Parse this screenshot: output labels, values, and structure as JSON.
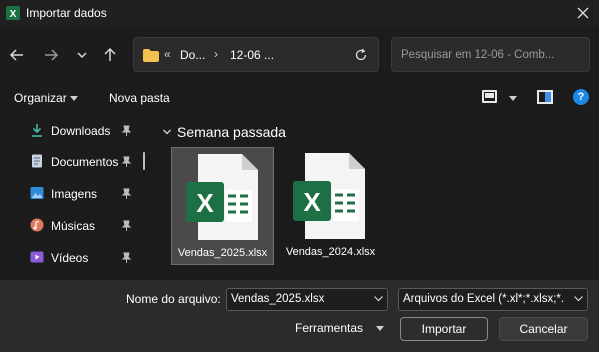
{
  "window": {
    "title": "Importar dados"
  },
  "address": {
    "crumbs": [
      "Do...",
      "12-06 ..."
    ],
    "overflow": "«"
  },
  "search": {
    "placeholder": "Pesquisar em 12-06 - Comb..."
  },
  "toolbar": {
    "organize_label": "Organizar",
    "new_folder_label": "Nova pasta"
  },
  "sidebar": {
    "items": [
      {
        "label": "Downloads",
        "icon": "download-icon"
      },
      {
        "label": "Documentos",
        "icon": "document-icon"
      },
      {
        "label": "Imagens",
        "icon": "image-icon"
      },
      {
        "label": "Músicas",
        "icon": "music-icon"
      },
      {
        "label": "Vídeos",
        "icon": "video-icon"
      }
    ]
  },
  "main": {
    "group_title": "Semana passada",
    "files": [
      {
        "name": "Vendas_2025.xlsx",
        "selected": true
      },
      {
        "name": "Vendas_2024.xlsx",
        "selected": false
      }
    ]
  },
  "footer": {
    "filename_label": "Nome do arquivo:",
    "filename_value": "Vendas_2025.xlsx",
    "filetype_value": "Arquivos do Excel (*.xl*;*.xlsx;*.",
    "tools_label": "Ferramentas",
    "open_label": "Importar",
    "cancel_label": "Cancelar"
  },
  "colors": {
    "excel_green": "#1d7044",
    "accent_blue": "#1e88e5",
    "folder_yellow": "#f2c14e"
  }
}
